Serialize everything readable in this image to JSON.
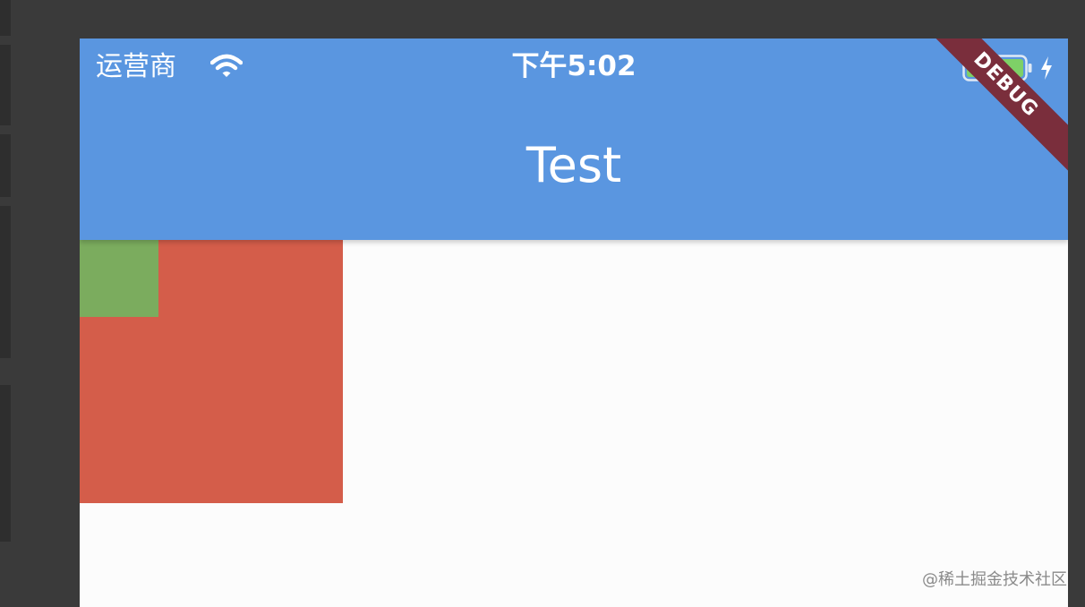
{
  "status_bar": {
    "carrier": "运营商",
    "time": "下午5:02",
    "wifi_icon": "wifi-icon",
    "battery_icon": "battery-icon",
    "charging_icon": "charging-bolt-icon"
  },
  "app_bar": {
    "title": "Test",
    "color": "#5a96e0"
  },
  "debug_banner": {
    "label": "DEBUG",
    "color": "#7a2e3c"
  },
  "content": {
    "red_box_color": "#d45d4a",
    "green_box_color": "#7bac5e",
    "background": "#fcfcfc"
  },
  "watermark": "@稀土掘金技术社区"
}
